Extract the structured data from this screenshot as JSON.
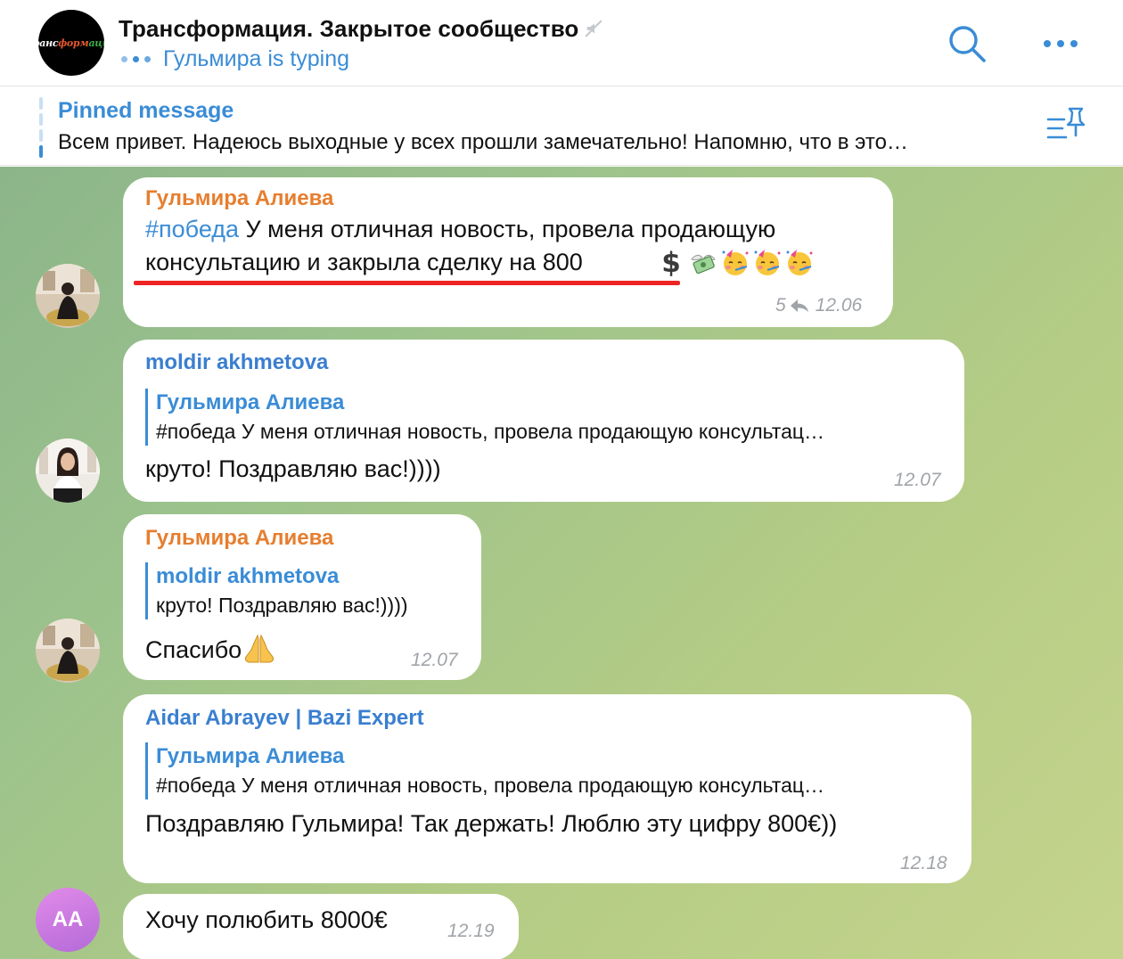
{
  "header": {
    "logo_text": [
      "Транс",
      "форм",
      "ация"
    ],
    "title": "Трансформация. Закрытое сообщество",
    "status": "Гульмира is typing",
    "colors": {
      "accent": "#3a8cd6"
    }
  },
  "pinned": {
    "label": "Pinned message",
    "text": "Всем привет. Надеюсь выходные у всех прошли замечательно!   Напомню, что в это…"
  },
  "messages": [
    {
      "sender": "Гульмира Алиева",
      "hashtag": "#победа",
      "line1": " У меня отличная новость, провела продающую",
      "line2": "консультацию и закрыла сделку на 800",
      "emojis": [
        "heavy-dollar-sign",
        "money-with-wings",
        "partying-face",
        "partying-face",
        "partying-face"
      ],
      "replies": "5",
      "time": "12.06"
    },
    {
      "sender": "moldir akhmetova",
      "reply_sender": "Гульмира Алиева",
      "reply_text": "#победа У меня отличная новость, провела продающую консультац…",
      "text": "круто! Поздравляю вас!))))",
      "time": "12.07"
    },
    {
      "sender": "Гульмира Алиева",
      "reply_sender": "moldir akhmetova",
      "reply_text": "круто! Поздравляю вас!))))",
      "text": "Спасибо",
      "emojis": [
        "folded-hands"
      ],
      "time": "12.07"
    },
    {
      "sender": "Aidar Abrayev | Bazi Expert",
      "reply_sender": "Гульмира Алиева",
      "reply_text": "#победа У меня отличная новость, провела продающую консультац…",
      "text": "Поздравляю Гульмира! Так держать! Люблю эту цифру 800€))",
      "time": "12.18"
    },
    {
      "avatar_initials": "AA",
      "text": "Хочу полюбить 8000€",
      "time": "12.19"
    }
  ]
}
